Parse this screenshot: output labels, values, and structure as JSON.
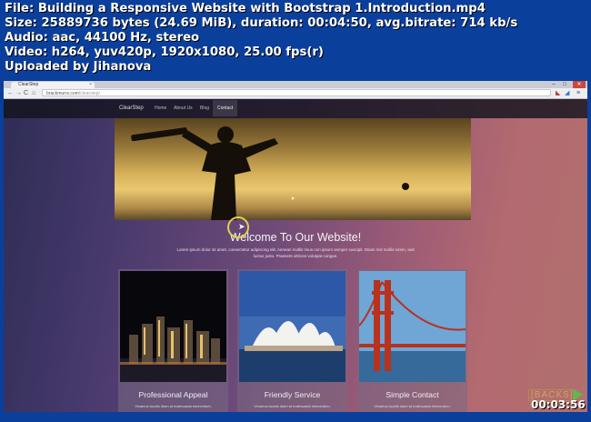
{
  "meta": {
    "file": "File: Building a Responsive Website with Bootstrap 1.Introduction.mp4",
    "size": "Size: 25889736 bytes (24.69 MiB), duration: 00:04:50, avg.bitrate: 714 kb/s",
    "audio": "Audio: aac, 44100 Hz, stereo",
    "video": "Video: h264, yuv420p, 1920x1080, 25.00 fps(r)",
    "uploader": "Uploaded by Jihanova"
  },
  "browser": {
    "tab_title": "ClearStep",
    "tab_close": "×",
    "url_host": "brackmurrs.com",
    "url_path": "/clearstep/",
    "back": "←",
    "forward": "→",
    "reload": "C",
    "home": "⌂",
    "minimize": "–",
    "maximize": "□",
    "close": "✕"
  },
  "site": {
    "brand": "ClearStep",
    "nav": [
      "Home",
      "About Us",
      "Blog",
      "Contact"
    ],
    "welcome": "Welcome To Our Website!",
    "intro": "Lorem ipsum dolor sit amet, consectetur adipiscing elit. Aenean mollis risus non ipsum semper suscipit. Etiam nisl mollis lorem, sed luctus justo. Praesent ultrices volutpat congue.",
    "cards": [
      {
        "title": "Professional Appeal",
        "text": "Vivamus iaculis diam at malesuada elementum."
      },
      {
        "title": "Friendly Service",
        "text": "Vivamus iaculis diam at malesuada elementum."
      },
      {
        "title": "Simple Contact",
        "text": "Vivamus iaculis diam at malesuada elementum."
      }
    ]
  },
  "player": {
    "timestamp": "00:03:56",
    "logo": "[BACKS]"
  }
}
